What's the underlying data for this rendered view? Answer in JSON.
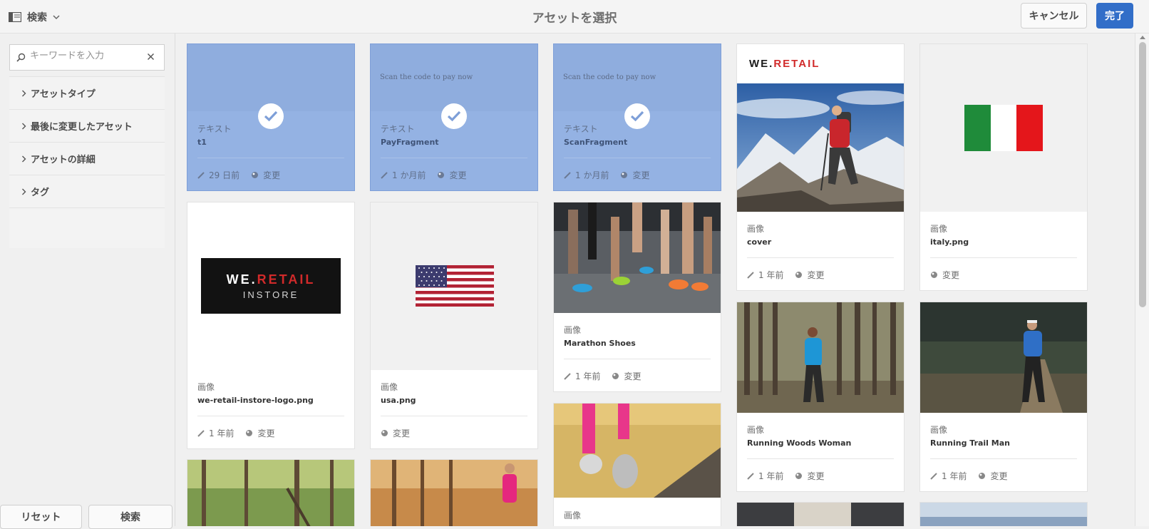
{
  "header": {
    "sidebar_toggle_label": "検索",
    "title": "アセットを選択",
    "cancel_label": "キャンセル",
    "done_label": "完了"
  },
  "sidebar": {
    "search_placeholder": "キーワードを入力",
    "facets": [
      {
        "label": "アセットタイプ"
      },
      {
        "label": "最後に変更したアセット"
      },
      {
        "label": "アセットの詳細"
      },
      {
        "label": "タグ"
      }
    ],
    "reset_label": "リセット",
    "search_label": "検索"
  },
  "cards": [
    {
      "type": "テキスト",
      "title": "t1",
      "modified": "29 日前",
      "status": "変更",
      "selected": true
    },
    {
      "type": "テキスト",
      "title": "PayFragment",
      "preview_text": "Scan the code to pay now",
      "modified": "1 か月前",
      "status": "変更",
      "selected": true
    },
    {
      "type": "テキスト",
      "title": "ScanFragment",
      "preview_text": "Scan the code to pay now",
      "modified": "1 か月前",
      "status": "変更",
      "selected": true
    },
    {
      "type": "画像",
      "title": "cover",
      "brand": "WE.RETAIL",
      "modified": "1 年前",
      "status": "変更"
    },
    {
      "type": "画像",
      "title": "italy.png",
      "status": "変更"
    },
    {
      "type": "画像",
      "title": "we-retail-instore-logo.png",
      "logo_line1": "WE.RETAIL",
      "logo_line2": "INSTORE",
      "modified": "1 年前",
      "status": "変更"
    },
    {
      "type": "画像",
      "title": "usa.png",
      "status": "変更"
    },
    {
      "type": "画像",
      "title": "Marathon Shoes",
      "modified": "1 年前",
      "status": "変更"
    },
    {
      "type": "画像",
      "title": "Running Woods Woman",
      "modified": "1 年前",
      "status": "変更"
    },
    {
      "type": "画像",
      "title": "Running Trail Man",
      "modified": "1 年前",
      "status": "変更"
    },
    {
      "type": "画像",
      "title": ""
    }
  ],
  "colors": {
    "accent": "#326ec8",
    "selected_card": "#94b2e3",
    "we_retail_red": "#d12a2a"
  }
}
